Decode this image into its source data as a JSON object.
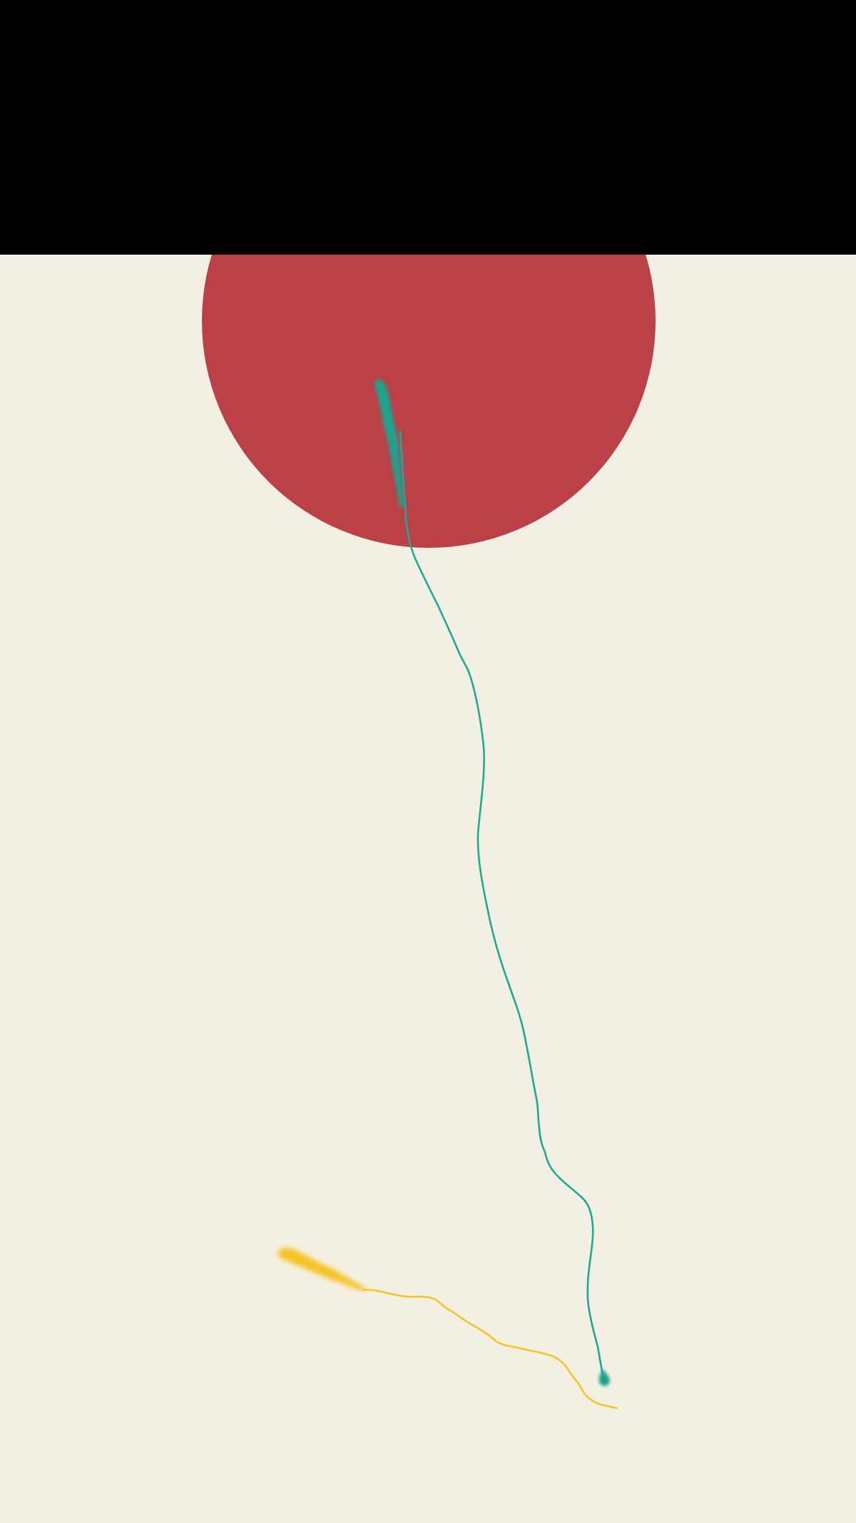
{
  "game": {
    "scene": "ink-drawing",
    "background_color": "#f3f0e3",
    "top_bar_color": "#000000",
    "target": {
      "shape": "circle",
      "color": "#bb4146"
    },
    "strokes": [
      {
        "name": "teal-stroke",
        "color": "#1aab96",
        "head_color": "#1aa38f"
      },
      {
        "name": "yellow-stroke",
        "color": "#f3c526",
        "head_color": "#f3c526"
      }
    ]
  }
}
